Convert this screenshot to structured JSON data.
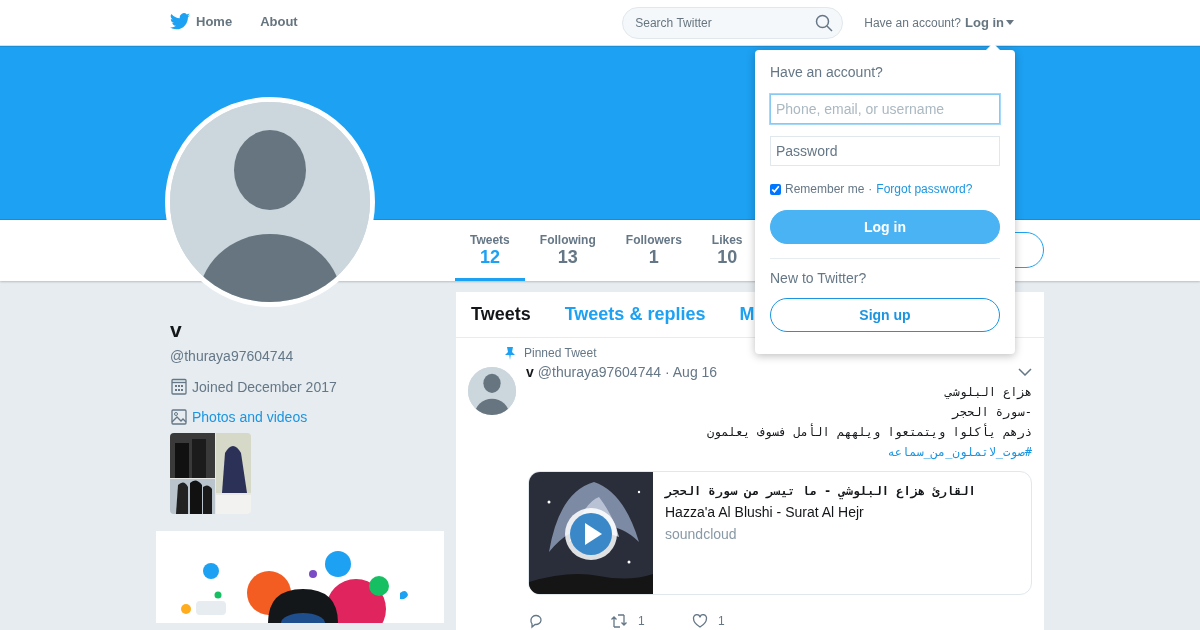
{
  "header": {
    "nav": [
      {
        "label": "Home"
      },
      {
        "label": "About"
      }
    ],
    "search": {
      "placeholder": "Search Twitter"
    },
    "account_prompt": "Have an account?",
    "login_link": "Log in"
  },
  "profile_nav": {
    "stats": [
      {
        "label": "Tweets",
        "value": "12",
        "selected": true
      },
      {
        "label": "Following",
        "value": "13",
        "selected": false
      },
      {
        "label": "Followers",
        "value": "1",
        "selected": false
      },
      {
        "label": "Likes",
        "value": "10",
        "selected": false
      }
    ]
  },
  "profile": {
    "name": "v",
    "handle": "@thuraya97604744",
    "joined": "Joined December 2017",
    "photos_link": "Photos and videos"
  },
  "timeline_tabs": [
    {
      "label": "Tweets",
      "selected": true
    },
    {
      "label": "Tweets & replies",
      "selected": false
    },
    {
      "label": "M",
      "selected": false
    }
  ],
  "tweet": {
    "pinned_label": "Pinned Tweet",
    "name": "v",
    "handle": "@thuraya97604744",
    "date": "· Aug 16",
    "lines": [
      "هزاع البلوشي",
      "-سورة الحجر",
      "ذرهم يأكلوا ويتمتعوا ويلههم الأمل فسوف يعلمون"
    ],
    "hashtag": "#صوت_لاتملون_من_سماعه",
    "card": {
      "title": "القارئ هزاع البلوشي - ما تيسر من سورة الحجر",
      "subtitle": "Hazza'a Al Blushi - Surat Al Hejr",
      "source": "soundcloud"
    },
    "actions": [
      {
        "kind": "reply"
      },
      {
        "kind": "retweet",
        "count": "1"
      },
      {
        "kind": "like",
        "count": "1"
      }
    ]
  },
  "login_dropdown": {
    "title": "Have an account?",
    "username": {
      "placeholder": "Phone, email, or username"
    },
    "password": {
      "placeholder": "Password"
    },
    "remember": {
      "label": "Remember me",
      "checked": true
    },
    "separator": "·",
    "forgot_link": "Forgot password?",
    "login_button": "Log in",
    "signup_prompt": "New to Twitter?",
    "signup_button": "Sign up"
  }
}
